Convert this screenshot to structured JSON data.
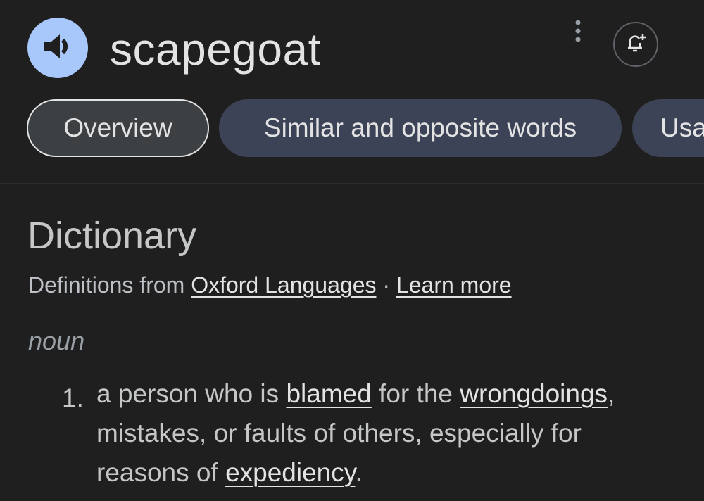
{
  "entry": {
    "word": "scapegoat",
    "speaker_icon": "volume-icon",
    "menu_icon": "more-vert-icon",
    "alert_icon": "add-alert-icon"
  },
  "tabs": [
    {
      "label": "Overview",
      "selected": true
    },
    {
      "label": "Similar and opposite words",
      "selected": false
    },
    {
      "label": "Usa",
      "selected": false
    }
  ],
  "dictionary": {
    "title": "Dictionary",
    "source_prefix": "Definitions from ",
    "source_link": "Oxford Languages",
    "separator": " · ",
    "learn_more": "Learn more",
    "part_of_speech": "noun",
    "definitions": [
      {
        "number": "1.",
        "t1": "a person who is ",
        "l1": "blamed",
        "t2": " for the ",
        "l2": "wrongdoings",
        "t3": ", mistakes, or faults of others, especially for reasons of ",
        "l3": "expediency",
        "t4": "."
      }
    ]
  },
  "colors": {
    "background": "#1f1f1f",
    "speaker_bg": "#a8c7fa",
    "tab_bg": "#3c4356",
    "text": "#e3e3e3"
  }
}
